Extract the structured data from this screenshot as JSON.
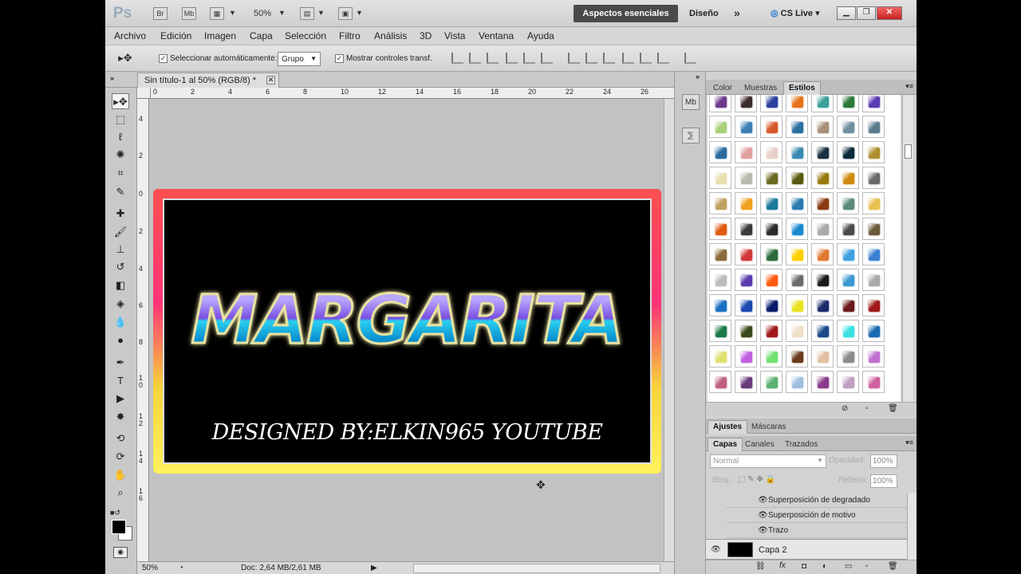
{
  "app": {
    "logo": "Ps",
    "title_icons": [
      "Br",
      "Mb"
    ],
    "zoom": "50%"
  },
  "workspace": {
    "active": "Aspectos esenciales",
    "design": "Diseño",
    "more": "»",
    "cslive": "CS Live"
  },
  "menu": [
    "Archivo",
    "Edición",
    "Imagen",
    "Capa",
    "Selección",
    "Filtro",
    "Análisis",
    "3D",
    "Vista",
    "Ventana",
    "Ayuda"
  ],
  "options": {
    "auto_select_label": "Seleccionar automáticamente:",
    "auto_select_value": "Grupo",
    "show_transform_label": "Mostrar controles transf."
  },
  "document": {
    "tab_title": "Sin título-1 al 50% (RGB/8) *",
    "main_text": "MARGARITA",
    "credit_text": "DESIGNED BY:ELKIN965 YOUTUBE"
  },
  "rulers": {
    "top": [
      "0",
      "2",
      "4",
      "6",
      "8",
      "10",
      "12",
      "14",
      "16",
      "18",
      "20",
      "22",
      "24",
      "26"
    ],
    "left": [
      "4",
      "2",
      "0",
      "2",
      "4",
      "6",
      "8",
      "1\n0",
      "1\n2",
      "1\n4",
      "1\n6"
    ]
  },
  "status": {
    "zoom": "50%",
    "doc": "Doc: 2,64 MB/2,61 MB"
  },
  "panels": {
    "top_tabs": [
      "Color",
      "Muestras",
      "Estilos"
    ],
    "top_active": 2,
    "adj_tabs": [
      "Ajustes",
      "Máscaras"
    ],
    "layer_tabs": [
      "Capas",
      "Canales",
      "Trazados"
    ],
    "blend_mode": "Normal",
    "opacity_label": "Opacidad:",
    "opacity": "100%",
    "lock_label": "Bloq.:",
    "fill_label": "Relleno:",
    "fill": "100%",
    "effects": [
      "Superposición de degradado",
      "Superposición de motivo",
      "Trazo"
    ],
    "layer_name": "Capa 2"
  },
  "style_colors": [
    "#6b3a8a",
    "#3a2a2a",
    "#2b3f9e",
    "#e8731a",
    "#3aa09a",
    "#2c7a3a",
    "#5a3ab0",
    "#a8d07a",
    "#3b7fb5",
    "#d65a2a",
    "#2a6fa0",
    "#a88f7a",
    "#6f8fa0",
    "#5a7a8a",
    "#2a6aa0",
    "#e0a0a0",
    "#e8d0c8",
    "#3a8ab0",
    "#1a3040",
    "#0a2a3a",
    "#b09030",
    "#e8e0b0",
    "#b8b8b0",
    "#6a6a20",
    "#5a5a10",
    "#9a7a10",
    "#d08a10",
    "#6a6a6a",
    "#c0a060",
    "#f0a020",
    "#1a7a9a",
    "#2a7ab0",
    "#8a3a10",
    "#5a8a7a",
    "#e8c050",
    "#e05a10",
    "#3a3a3a",
    "#2a2a2a",
    "#1a8ad0",
    "#aaaaaa",
    "#4a4a4a",
    "#6a5a3a",
    "#8a6a3a",
    "#d03a3a",
    "#2a6a3a",
    "#ffd000",
    "#e07a30",
    "#40a0e0",
    "#3a80d0",
    "#bbbbbb",
    "#5a3ab0",
    "#ff5a10",
    "#6a6a6a",
    "#1a1a1a",
    "#3a9ad0",
    "#aaaaaa",
    "#1a70c0",
    "#1a4ab0",
    "#0a1a6a",
    "#e8e020",
    "#1a2a6a",
    "#6a1a1a",
    "#a01a1a",
    "#1a7a4a",
    "#3a4a1a",
    "#a01a1a",
    "#f0e0c8",
    "#1a4a8a",
    "#3ae0e0",
    "#1a6ab0",
    "#e0e070",
    "#c060e0",
    "#70e070",
    "#6a3a1a",
    "#e0c0a0",
    "#8a8a8a",
    "#c070d0",
    "#c06080",
    "#6a3a7a",
    "#5ab070",
    "#a0c0e0",
    "#8a3a8a",
    "#c0a0c0",
    "#d060a0"
  ]
}
